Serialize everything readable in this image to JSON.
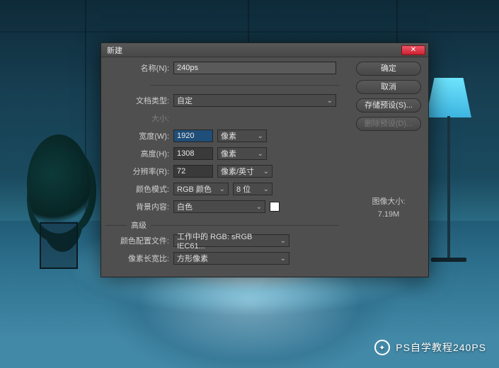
{
  "dialog": {
    "title": "新建",
    "name_label": "名称(N):",
    "name_value": "240ps",
    "doc_type_label": "文档类型:",
    "doc_type_value": "自定",
    "size_label": "大小:",
    "width_label": "宽度(W):",
    "width_value": "1920",
    "height_label": "高度(H):",
    "height_value": "1308",
    "unit_px": "像素",
    "res_label": "分辨率(R):",
    "res_value": "72",
    "res_unit": "像素/英寸",
    "mode_label": "颜色模式:",
    "mode_value": "RGB 颜色",
    "bit_value": "8 位",
    "bg_label": "背景内容:",
    "bg_value": "白色",
    "advanced": "高级",
    "profile_label": "颜色配置文件:",
    "profile_value": "工作中的 RGB: sRGB IEC61...",
    "aspect_label": "像素长宽比:",
    "aspect_value": "方形像素",
    "image_size_label": "图像大小:",
    "image_size_value": "7.19M",
    "buttons": {
      "ok": "确定",
      "cancel": "取消",
      "save_preset": "存储预设(S)...",
      "delete_preset": "删除预设(D)..."
    },
    "close_glyph": "✕"
  },
  "watermark": {
    "icon": "✦",
    "text": "PS自学教程240PS"
  }
}
